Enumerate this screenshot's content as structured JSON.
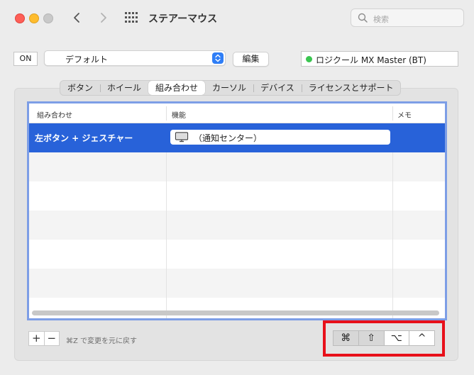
{
  "window": {
    "title": "ステアーマウス",
    "search_placeholder": "検索"
  },
  "toolbar": {
    "on_label": "ON",
    "preset": "デフォルト",
    "edit_label": "編集",
    "device": "ロジクール MX Master (BT)",
    "device_status_color": "#3ac550"
  },
  "tabs": [
    {
      "label": "ボタン",
      "active": false
    },
    {
      "label": "ホイール",
      "active": false
    },
    {
      "label": "組み合わせ",
      "active": true
    },
    {
      "label": "カーソル",
      "active": false
    },
    {
      "label": "デバイス",
      "active": false
    },
    {
      "label": "ライセンスとサポート",
      "active": false
    }
  ],
  "table": {
    "headers": [
      "組み合わせ",
      "機能",
      "メモ"
    ],
    "rows": [
      {
        "combo": "左ボタン + ジェスチャー",
        "function": "（通知センター）",
        "memo": "",
        "selected": true
      }
    ],
    "selection_color": "#2862d9"
  },
  "footer": {
    "add_label": "+",
    "remove_label": "−",
    "undo_hint": "⌘Z で変更を元に戻す",
    "modifiers": [
      {
        "symbol": "⌘",
        "name": "command",
        "active": true
      },
      {
        "symbol": "⇧",
        "name": "shift",
        "active": true
      },
      {
        "symbol": "⌥",
        "name": "option",
        "active": false
      },
      {
        "symbol": "^",
        "name": "control",
        "active": false
      }
    ]
  }
}
